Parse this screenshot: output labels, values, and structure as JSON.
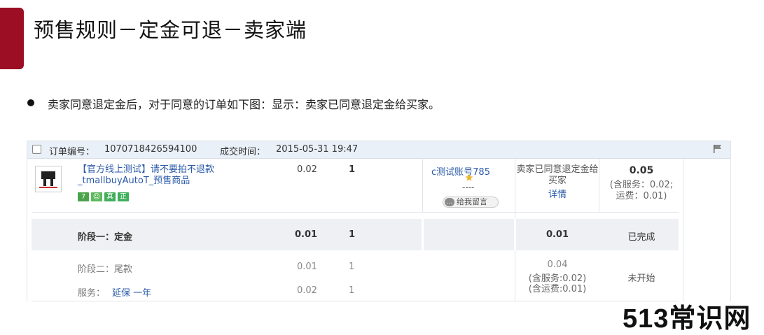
{
  "slide": {
    "title": "预售规则－定金可退－卖家端",
    "bullet": "卖家同意退定金后，对于同意的订单如下图：显示：卖家已同意退定金给买家。",
    "accent_color": "#9b0e23"
  },
  "order": {
    "header": {
      "order_label": "订单编号：",
      "order_no": "1070718426594100",
      "time_label": "成交时间：",
      "time": "2015-05-31 19:47"
    },
    "product": {
      "title": "【官方线上测试】请不要拍不退款_tmallbuyAutoT_预售商品",
      "tags": [
        {
          "text": "7",
          "color": "#4aa34a"
        },
        {
          "text": "☺",
          "color": "#5cb85c"
        },
        {
          "text": "真",
          "color": "#3fae5a"
        },
        {
          "text": "正",
          "color": "#3fae5a"
        }
      ],
      "price": "0.02",
      "quantity": "1"
    },
    "buyer": {
      "name": "c测试账号785",
      "dash": "----",
      "message_button": "给我留言"
    },
    "status": {
      "text": "卖家已同意退定金给买家",
      "detail_link": "详情"
    },
    "total": {
      "amount": "0.05",
      "service": "(含服务：0.02;",
      "shipping": "运费：0.01)"
    },
    "stage1": {
      "label": "阶段一：定金",
      "price": "0.01",
      "quantity": "1",
      "amount": "0.01",
      "status": "已完成"
    },
    "stage2": {
      "label": "阶段二：尾款",
      "price": "0.01",
      "quantity": "1",
      "amount": "0.04",
      "service": "(含服务:0.02)",
      "shipping": "(含运费:0.01)",
      "status": "未开始"
    },
    "service_item": {
      "label": "服务：",
      "link": "延保 一年",
      "price": "0.02",
      "quantity": "1"
    }
  },
  "watermark": "513常识网"
}
